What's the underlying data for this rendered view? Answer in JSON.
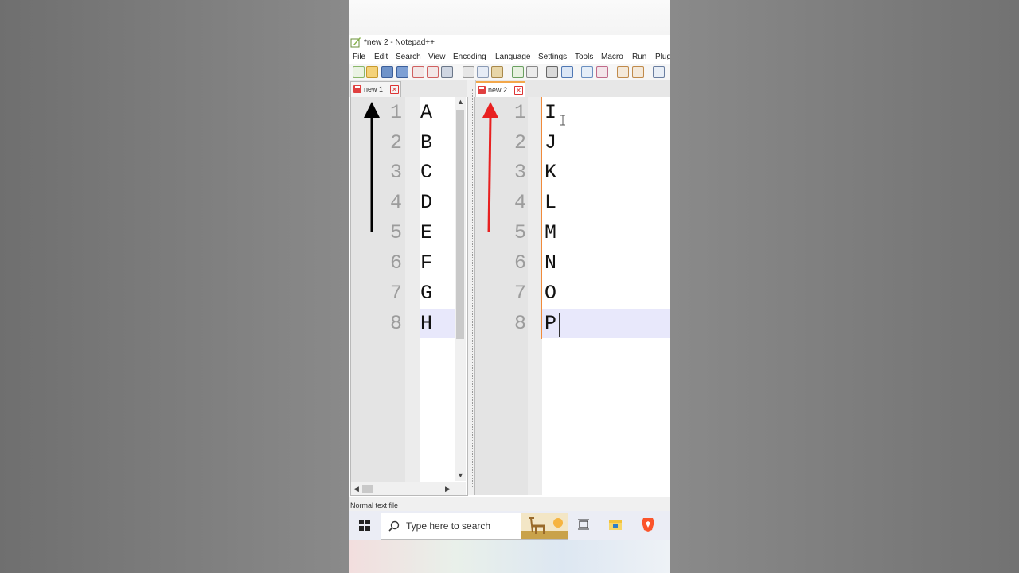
{
  "window": {
    "title": "*new 2 - Notepad++"
  },
  "menu": [
    "File",
    "Edit",
    "Search",
    "View",
    "Encoding",
    "Language",
    "Settings",
    "Tools",
    "Macro",
    "Run",
    "Plug"
  ],
  "tabs": {
    "left": "new 1",
    "right": "new 2",
    "close_glyph": "✕"
  },
  "editor_left": {
    "line_numbers": [
      "1",
      "2",
      "3",
      "4",
      "5",
      "6",
      "7",
      "8"
    ],
    "lines": [
      "A",
      "B",
      "C",
      "D",
      "E",
      "F",
      "G",
      "H"
    ]
  },
  "editor_right": {
    "line_numbers": [
      "1",
      "2",
      "3",
      "4",
      "5",
      "6",
      "7",
      "8"
    ],
    "lines": [
      "I",
      "J",
      "K",
      "L",
      "M",
      "N",
      "O",
      "P"
    ]
  },
  "status": {
    "file_type": "Normal text file"
  },
  "taskbar": {
    "search_placeholder": "Type here to search"
  },
  "colors": {
    "accent_tab": "#f3a74a",
    "annotation_left_arrow": "#000000",
    "annotation_right_arrow": "#e82020",
    "current_line": "#e8e8fb",
    "change_marker": "#f08a3a"
  },
  "icons": {
    "start": "windows-start-icon",
    "search": "search-icon",
    "task_view": "task-view-icon",
    "explorer": "file-explorer-icon",
    "brave": "brave-browser-icon"
  }
}
